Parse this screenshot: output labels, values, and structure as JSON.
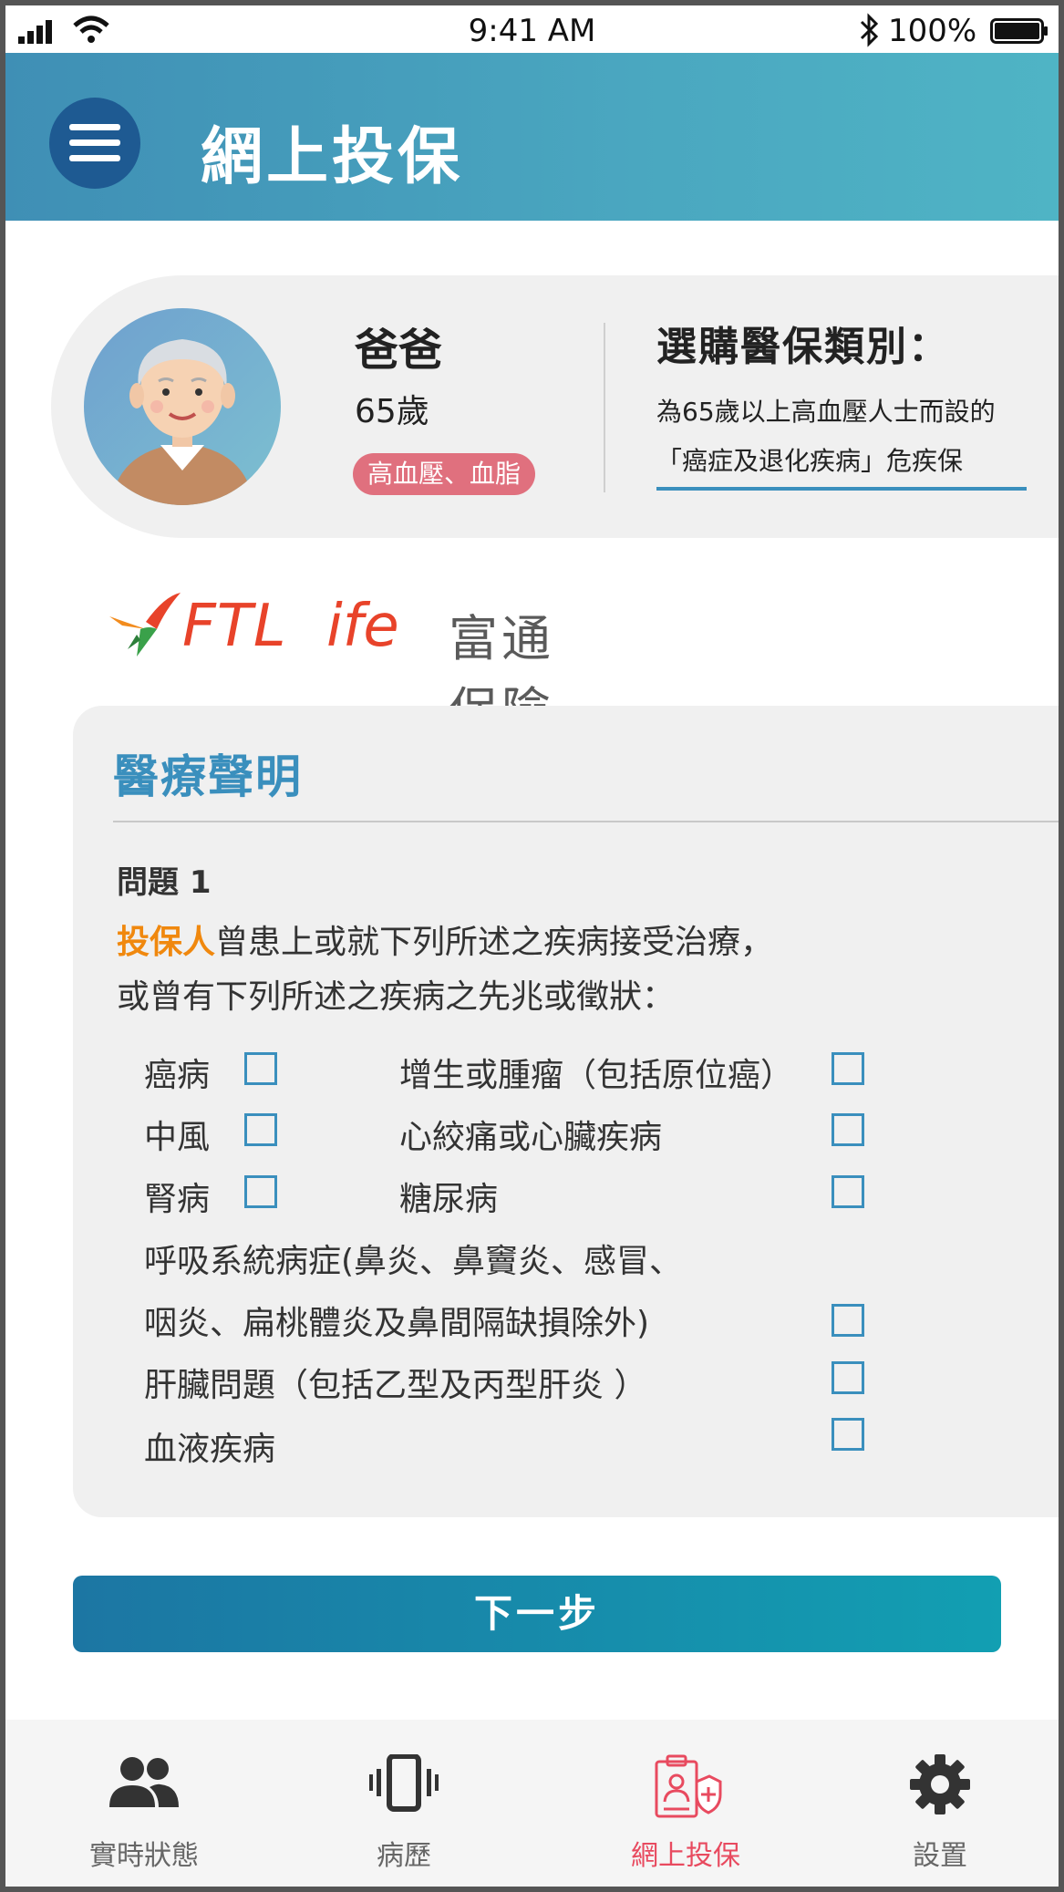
{
  "status_bar": {
    "time": "9:41 AM",
    "battery": "100%"
  },
  "header": {
    "title": "網上投保",
    "menu_icon": "hamburger-menu-icon"
  },
  "profile": {
    "name": "爸爸",
    "age": "65歲",
    "conditions_badge": "高血壓、血脂",
    "plan_title": "選購醫保類別：",
    "plan_desc_line1": "為65歲以上高血壓人士而設的",
    "plan_desc_line2": "「癌症及退化疾病」危疾保"
  },
  "logo": {
    "brand_en_ft": "FTL",
    "brand_en_life": "ife",
    "brand_cn": "富通保險"
  },
  "medical": {
    "title": "醫療聲明",
    "question_number": "問題 1",
    "question_highlight": "投保人",
    "question_line1_rest": "曾患上或就下列所述之疾病接受治療，",
    "question_line2": "或曾有下列所述之疾病之先兆或徵狀：",
    "conditions": {
      "cancer": "癌病",
      "growth": "增生或腫瘤（包括原位癌）",
      "stroke": "中風",
      "heart": "心絞痛或心臟疾病",
      "kidney": "腎病",
      "diabetes": "糖尿病",
      "respiratory_line1": "呼吸系統病症(鼻炎、鼻竇炎、感冒、",
      "respiratory_line2": "咽炎、扁桃體炎及鼻間隔缺損除外)",
      "liver": "肝臟問題（包括乙型及丙型肝炎 ）",
      "blood": "血液疾病"
    }
  },
  "next_button": "下一步",
  "nav": {
    "items": [
      {
        "label": "實時狀態",
        "icon": "people-icon"
      },
      {
        "label": "病歷",
        "icon": "vibrating-phone-icon"
      },
      {
        "label": "網上投保",
        "icon": "insurance-document-icon",
        "active": true
      },
      {
        "label": "設置",
        "icon": "gear-icon"
      }
    ]
  },
  "colors": {
    "header_start": "#3f8fb5",
    "header_end": "#4fb4c5",
    "accent_blue": "#3a8fbd",
    "highlight_orange": "#f0880e",
    "badge_red": "#e0707e",
    "nav_active": "#e84a5f"
  }
}
